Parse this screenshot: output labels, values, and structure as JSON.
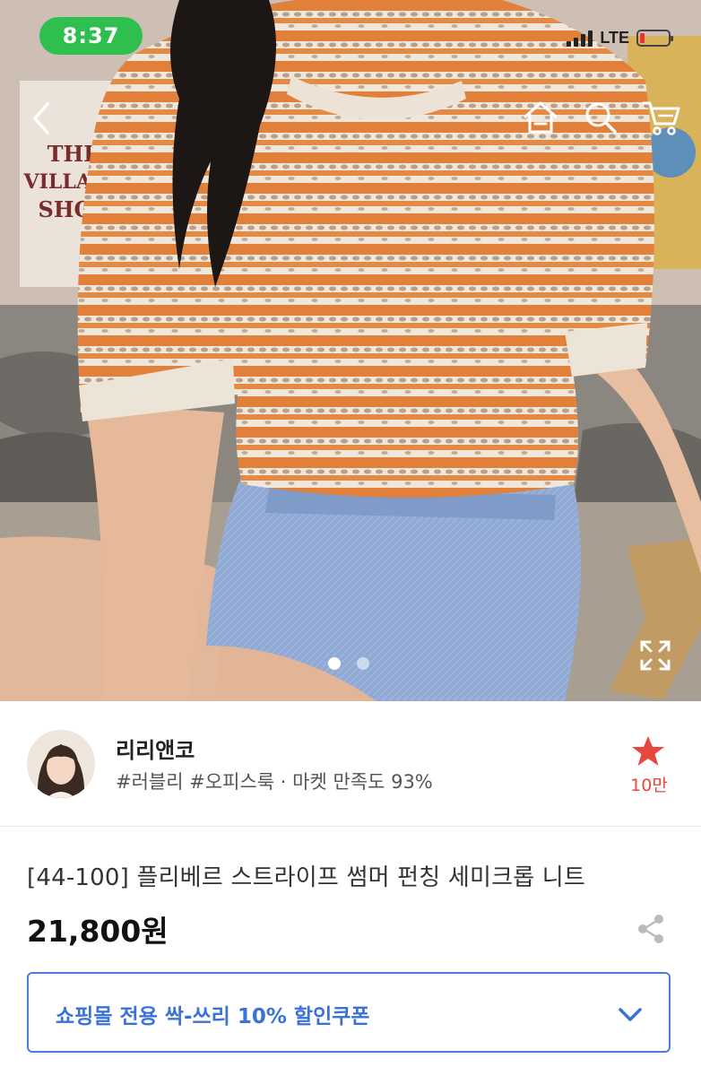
{
  "status_bar": {
    "time": "8:37",
    "network": "LTE"
  },
  "top_nav": {
    "icons": [
      "back-icon",
      "home-icon",
      "search-icon",
      "cart-icon"
    ]
  },
  "gallery": {
    "page_count": 2,
    "active_index": 0,
    "expand_icon": "expand-icon"
  },
  "seller": {
    "name": "리리앤코",
    "tags": "#러블리 #오피스룩 · 마켓 만족도 93%",
    "favorite_count": "10만"
  },
  "product": {
    "title": "[44-100] 플리베르 스트라이프 썸머 펀칭 세미크롭 니트",
    "price": "21,800원"
  },
  "coupon": {
    "label": "쇼핑몰 전용 싹-쓰리 10% 할인쿠폰"
  },
  "colors": {
    "accent_blue": "#3a72d8",
    "favorite_red": "#e8473c",
    "status_green": "#2fbf4f",
    "sweater_orange": "#e0803a"
  }
}
